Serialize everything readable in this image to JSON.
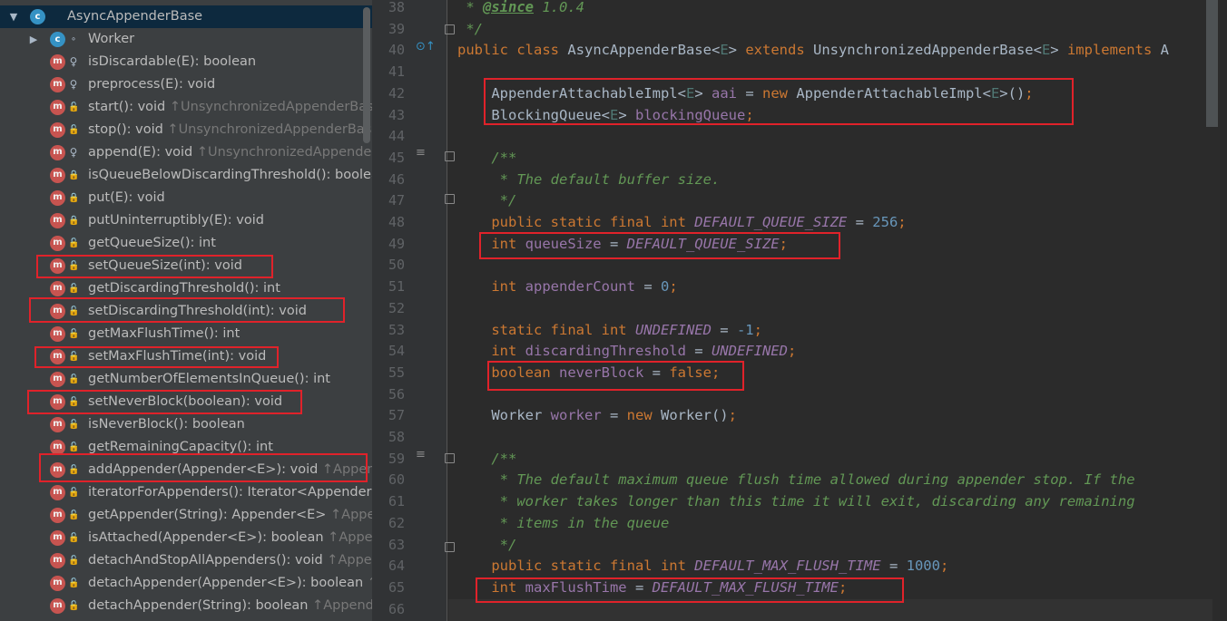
{
  "structure": {
    "rows": [
      {
        "name": "AsyncAppenderBase",
        "inh": "",
        "icon": "class",
        "vis": "",
        "arrow": "down",
        "indent": 0,
        "sel": true
      },
      {
        "name": "Worker",
        "inh": "",
        "icon": "class",
        "vis": "static",
        "arrow": "right",
        "indent": 1
      },
      {
        "name": "isDiscardable(E): boolean",
        "inh": "",
        "icon": "method",
        "vis": "pkg",
        "indent": 1
      },
      {
        "name": "preprocess(E): void",
        "inh": "",
        "icon": "method",
        "vis": "pkg",
        "indent": 1
      },
      {
        "name": "start(): void ",
        "inh": "↑UnsynchronizedAppenderBase",
        "icon": "method",
        "vis": "pub",
        "indent": 1
      },
      {
        "name": "stop(): void ",
        "inh": "↑UnsynchronizedAppenderBase",
        "icon": "method",
        "vis": "pub",
        "indent": 1
      },
      {
        "name": "append(E): void ",
        "inh": "↑UnsynchronizedAppenderBase",
        "icon": "method",
        "vis": "pkg",
        "indent": 1
      },
      {
        "name": "isQueueBelowDiscardingThreshold(): boolean",
        "inh": "",
        "icon": "method",
        "vis": "priv",
        "indent": 1
      },
      {
        "name": "put(E): void",
        "inh": "",
        "icon": "method",
        "vis": "priv",
        "indent": 1
      },
      {
        "name": "putUninterruptibly(E): void",
        "inh": "",
        "icon": "method",
        "vis": "priv",
        "indent": 1
      },
      {
        "name": "getQueueSize(): int",
        "inh": "",
        "icon": "method",
        "vis": "pub",
        "indent": 1
      },
      {
        "name": "setQueueSize(int): void",
        "inh": "",
        "icon": "method",
        "vis": "pub",
        "indent": 1
      },
      {
        "name": "getDiscardingThreshold(): int",
        "inh": "",
        "icon": "method",
        "vis": "pub",
        "indent": 1
      },
      {
        "name": "setDiscardingThreshold(int): void",
        "inh": "",
        "icon": "method",
        "vis": "pub",
        "indent": 1
      },
      {
        "name": "getMaxFlushTime(): int",
        "inh": "",
        "icon": "method",
        "vis": "pub",
        "indent": 1
      },
      {
        "name": "setMaxFlushTime(int): void",
        "inh": "",
        "icon": "method",
        "vis": "pub",
        "indent": 1
      },
      {
        "name": "getNumberOfElementsInQueue(): int",
        "inh": "",
        "icon": "method",
        "vis": "pub",
        "indent": 1
      },
      {
        "name": "setNeverBlock(boolean): void",
        "inh": "",
        "icon": "method",
        "vis": "pub",
        "indent": 1
      },
      {
        "name": "isNeverBlock(): boolean",
        "inh": "",
        "icon": "method",
        "vis": "pub",
        "indent": 1
      },
      {
        "name": "getRemainingCapacity(): int",
        "inh": "",
        "icon": "method",
        "vis": "pub",
        "indent": 1
      },
      {
        "name": "addAppender(Appender<E>): void ",
        "inh": "↑AppenderAttachable",
        "icon": "method",
        "vis": "pub",
        "indent": 1
      },
      {
        "name": "iteratorForAppenders(): Iterator<Appender<E>>",
        "inh": "",
        "icon": "method",
        "vis": "pub",
        "indent": 1
      },
      {
        "name": "getAppender(String): Appender<E> ",
        "inh": "↑AppenderAttachable",
        "icon": "method",
        "vis": "pub",
        "indent": 1
      },
      {
        "name": "isAttached(Appender<E>): boolean ",
        "inh": "↑AppenderAttachable",
        "icon": "method",
        "vis": "pub",
        "indent": 1
      },
      {
        "name": "detachAndStopAllAppenders(): void ",
        "inh": "↑AppenderAttachable",
        "icon": "method",
        "vis": "pub",
        "indent": 1
      },
      {
        "name": "detachAppender(Appender<E>): boolean ",
        "inh": "↑AppenderAttachable",
        "icon": "method",
        "vis": "pub",
        "indent": 1
      },
      {
        "name": "detachAppender(String): boolean ",
        "inh": "↑AppenderAttachable",
        "icon": "method",
        "vis": "pub",
        "indent": 1
      }
    ]
  },
  "editor": {
    "lines": [
      {
        "n": "38",
        "t": [
          [
            "cm",
            " * "
          ],
          [
            "tag",
            "@since"
          ],
          [
            "cm",
            " 1.0.4"
          ]
        ]
      },
      {
        "n": "39",
        "t": [
          [
            "cm",
            " */"
          ]
        ]
      },
      {
        "n": "40",
        "t": [
          [
            "kw",
            "public class "
          ],
          [
            "ty",
            "AsyncAppenderBase<"
          ],
          [
            "tp",
            "E"
          ],
          [
            "ty",
            "> "
          ],
          [
            "kw",
            "extends "
          ],
          [
            "ty",
            "UnsynchronizedAppenderBase<"
          ],
          [
            "tp",
            "E"
          ],
          [
            "ty",
            "> "
          ],
          [
            "kw",
            "implements "
          ],
          [
            "ty",
            "A"
          ]
        ]
      },
      {
        "n": "41",
        "t": []
      },
      {
        "n": "42",
        "t": [
          [
            "ty",
            "    AppenderAttachableImpl<"
          ],
          [
            "tp",
            "E"
          ],
          [
            "ty",
            "> "
          ],
          [
            "fld",
            "aai"
          ],
          [
            "ty",
            " = "
          ],
          [
            "kw",
            "new "
          ],
          [
            "ty",
            "AppenderAttachableImpl<"
          ],
          [
            "tp",
            "E"
          ],
          [
            "ty",
            ">()"
          ],
          [
            "kw",
            ";"
          ]
        ]
      },
      {
        "n": "43",
        "t": [
          [
            "ty",
            "    BlockingQueue<"
          ],
          [
            "tp",
            "E"
          ],
          [
            "ty",
            "> "
          ],
          [
            "fld",
            "blockingQueue"
          ],
          [
            "kw",
            ";"
          ]
        ]
      },
      {
        "n": "44",
        "t": []
      },
      {
        "n": "45",
        "t": [
          [
            "cm",
            "    /**"
          ]
        ]
      },
      {
        "n": "46",
        "t": [
          [
            "cm",
            "     * The default buffer size."
          ]
        ]
      },
      {
        "n": "47",
        "t": [
          [
            "cm",
            "     */"
          ]
        ]
      },
      {
        "n": "48",
        "t": [
          [
            "kw",
            "    public static final int "
          ],
          [
            "sf",
            "DEFAULT_QUEUE_SIZE"
          ],
          [
            "ty",
            " = "
          ],
          [
            "num",
            "256"
          ],
          [
            "kw",
            ";"
          ]
        ]
      },
      {
        "n": "49",
        "t": [
          [
            "kw",
            "    int "
          ],
          [
            "fld",
            "queueSize"
          ],
          [
            "ty",
            " = "
          ],
          [
            "sf",
            "DEFAULT_QUEUE_SIZE"
          ],
          [
            "kw",
            ";"
          ]
        ]
      },
      {
        "n": "50",
        "t": []
      },
      {
        "n": "51",
        "t": [
          [
            "kw",
            "    int "
          ],
          [
            "fld",
            "appenderCount"
          ],
          [
            "ty",
            " = "
          ],
          [
            "num",
            "0"
          ],
          [
            "kw",
            ";"
          ]
        ]
      },
      {
        "n": "52",
        "t": []
      },
      {
        "n": "53",
        "t": [
          [
            "kw",
            "    static final int "
          ],
          [
            "sf",
            "UNDEFINED"
          ],
          [
            "ty",
            " = "
          ],
          [
            "num",
            "-1"
          ],
          [
            "kw",
            ";"
          ]
        ]
      },
      {
        "n": "54",
        "t": [
          [
            "kw",
            "    int "
          ],
          [
            "fld",
            "discardingThreshold"
          ],
          [
            "ty",
            " = "
          ],
          [
            "sf",
            "UNDEFINED"
          ],
          [
            "kw",
            ";"
          ]
        ]
      },
      {
        "n": "55",
        "t": [
          [
            "kw",
            "    boolean "
          ],
          [
            "fld",
            "neverBlock"
          ],
          [
            "ty",
            " = "
          ],
          [
            "kw",
            "false;"
          ]
        ]
      },
      {
        "n": "56",
        "t": []
      },
      {
        "n": "57",
        "t": [
          [
            "ty",
            "    Worker "
          ],
          [
            "fld",
            "worker"
          ],
          [
            "ty",
            " = "
          ],
          [
            "kw",
            "new "
          ],
          [
            "ty",
            "Worker()"
          ],
          [
            "kw",
            ";"
          ]
        ]
      },
      {
        "n": "58",
        "t": []
      },
      {
        "n": "59",
        "t": [
          [
            "cm",
            "    /**"
          ]
        ]
      },
      {
        "n": "60",
        "t": [
          [
            "cm",
            "     * The default maximum queue flush time allowed during appender stop. If the"
          ]
        ]
      },
      {
        "n": "61",
        "t": [
          [
            "cm",
            "     * worker takes longer than this time it will exit, discarding any remaining"
          ]
        ]
      },
      {
        "n": "62",
        "t": [
          [
            "cm",
            "     * items in the queue"
          ]
        ]
      },
      {
        "n": "63",
        "t": [
          [
            "cm",
            "     */"
          ]
        ]
      },
      {
        "n": "64",
        "t": [
          [
            "kw",
            "    public static final int "
          ],
          [
            "sf",
            "DEFAULT_MAX_FLUSH_TIME"
          ],
          [
            "ty",
            " = "
          ],
          [
            "num",
            "1000"
          ],
          [
            "kw",
            ";"
          ]
        ]
      },
      {
        "n": "65",
        "t": [
          [
            "kw",
            "    int "
          ],
          [
            "fld",
            "maxFlushTime"
          ],
          [
            "ty",
            " = "
          ],
          [
            "sf",
            "DEFAULT_MAX_FLUSH_TIME"
          ],
          [
            "kw",
            ";"
          ]
        ]
      },
      {
        "n": "66",
        "t": []
      }
    ]
  },
  "icons": {
    "class_letter": "c",
    "method_letter": "m",
    "lock": "🔒",
    "key": "♀"
  }
}
